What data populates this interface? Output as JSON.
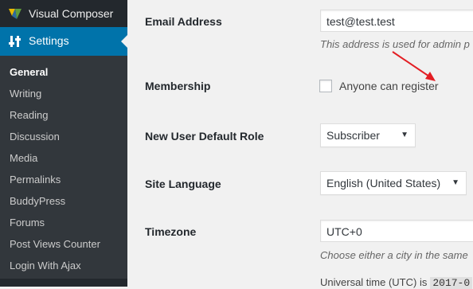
{
  "sidebar": {
    "top_item": {
      "label": "Visual Composer",
      "icon": "visual-composer-icon"
    },
    "current_item": {
      "label": "Settings",
      "icon": "settings-sliders-icon"
    },
    "submenu": [
      {
        "label": "General",
        "current": true
      },
      {
        "label": "Writing"
      },
      {
        "label": "Reading"
      },
      {
        "label": "Discussion"
      },
      {
        "label": "Media"
      },
      {
        "label": "Permalinks"
      },
      {
        "label": "BuddyPress"
      },
      {
        "label": "Forums"
      },
      {
        "label": "Post Views Counter"
      },
      {
        "label": "Login With Ajax"
      }
    ]
  },
  "form": {
    "email": {
      "label": "Email Address",
      "value": "test@test.test",
      "description": "This address is used for admin p"
    },
    "membership": {
      "label": "Membership",
      "checkbox_label": "Anyone can register",
      "checked": false
    },
    "default_role": {
      "label": "New User Default Role",
      "selected": "Subscriber"
    },
    "site_language": {
      "label": "Site Language",
      "selected": "English (United States)"
    },
    "timezone": {
      "label": "Timezone",
      "value": "UTC+0",
      "description": "Choose either a city in the same",
      "utc_prefix": "Universal time (UTC) is",
      "utc_value": "2017-0"
    }
  },
  "colors": {
    "sidebar_bg": "#23282d",
    "submenu_bg": "#32373c",
    "active_blue": "#0073aa",
    "annotation_red": "#e31e24"
  }
}
